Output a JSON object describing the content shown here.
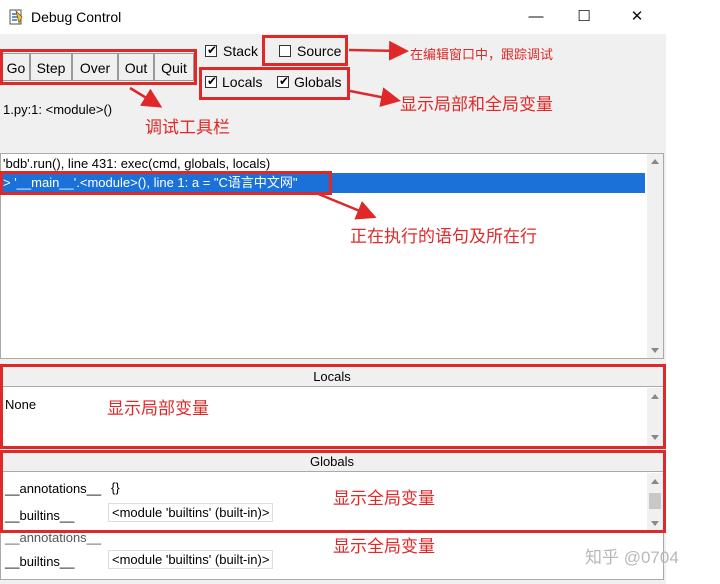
{
  "window": {
    "title": "Debug Control",
    "minimize": "—",
    "maximize": "☐",
    "close": "✕"
  },
  "toolbar": [
    "Go",
    "Step",
    "Over",
    "Out",
    "Quit"
  ],
  "options": {
    "stack": {
      "label": "Stack",
      "checked": true
    },
    "source": {
      "label": "Source",
      "checked": false
    },
    "locals": {
      "label": "Locals",
      "checked": true
    },
    "globals": {
      "label": "Globals",
      "checked": true
    }
  },
  "status": "1.py:1: <module>()",
  "stack_lines": [
    "'bdb'.run(), line 431: exec(cmd, globals, locals)",
    "> '__main__'.<module>(), line 1: a = \"C语言中文网\""
  ],
  "locals_panel": {
    "header": "Locals",
    "rows": [
      {
        "name": "None",
        "value": ""
      }
    ]
  },
  "globals_panel": {
    "header": "Globals",
    "rows": [
      {
        "name": "__annotations__",
        "value": "{}"
      },
      {
        "name": "__builtins__",
        "value": "<module 'builtins' (built-in)>"
      }
    ],
    "dup_rows": [
      {
        "name": "__annotations__",
        "value": "{}"
      },
      {
        "name": "__builtins__",
        "value": "<module 'builtins' (built-in)>"
      }
    ]
  },
  "annotations": {
    "source_note": "在编辑窗口中，跟踪调试",
    "vars_note": "显示局部和全局变量",
    "toolbar_note": "调试工具栏",
    "line_note": "正在执行的语句及所在行",
    "locals_note": "显示局部变量",
    "globals_note": "显示全局变量",
    "globals_note2": "显示全局变量"
  },
  "watermark": "知乎 @0704",
  "colors": {
    "highlight": "#1b71d8",
    "annotation_red": "#e02828"
  }
}
